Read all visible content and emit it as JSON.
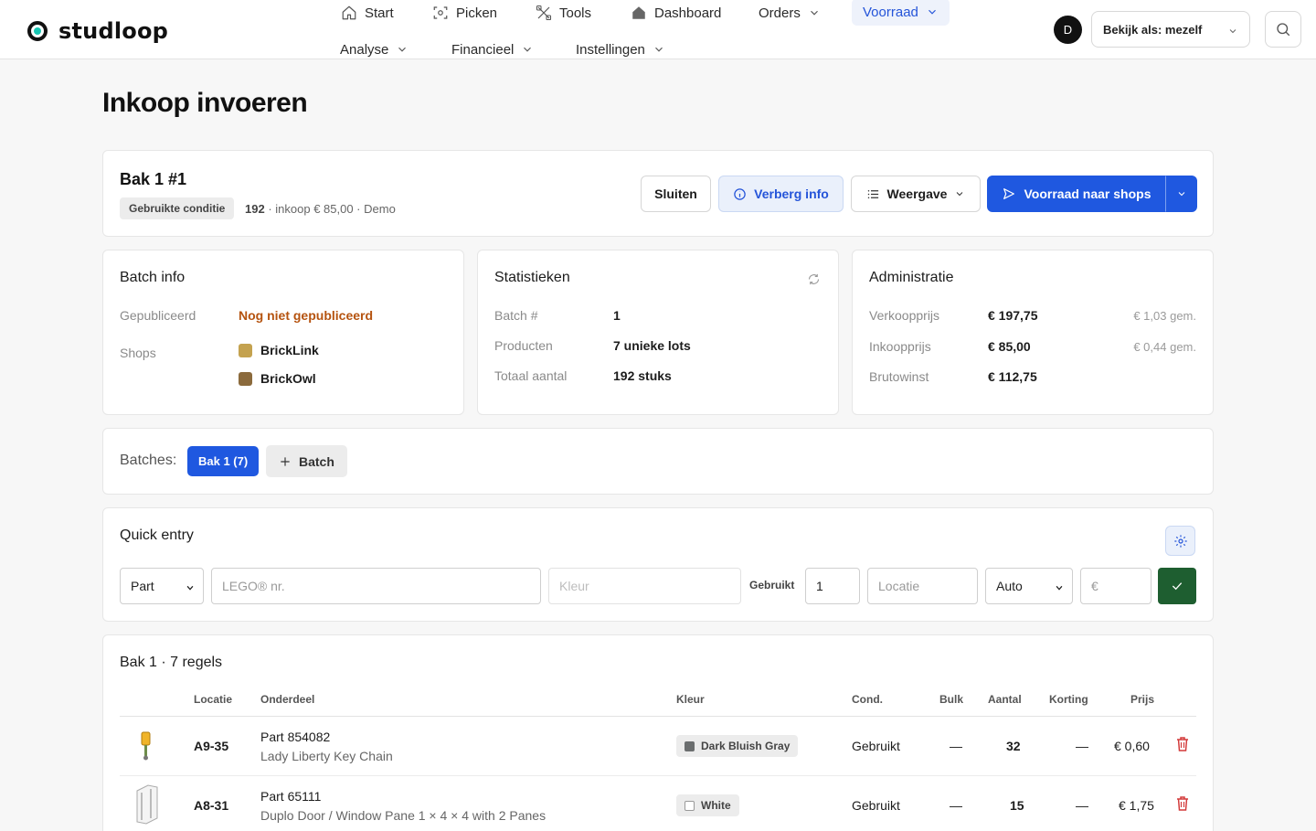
{
  "brand": {
    "name": "studloop"
  },
  "nav": {
    "start": "Start",
    "picken": "Picken",
    "tools": "Tools",
    "dashboard": "Dashboard",
    "orders": "Orders",
    "voorraad": "Voorraad",
    "analyse": "Analyse",
    "financieel": "Financieel",
    "instellingen": "Instellingen"
  },
  "user": {
    "initial": "D",
    "view_as": "Bekijk als: mezelf"
  },
  "page": {
    "title": "Inkoop invoeren"
  },
  "header": {
    "title": "Bak 1 #1",
    "condition": "Gebruikte conditie",
    "count": "192",
    "meta": "· inkoop € 85,00 · Demo",
    "close": "Sluiten",
    "hide_info": "Verberg info",
    "view": "Weergave",
    "push": "Voorraad naar shops"
  },
  "batch_info": {
    "title": "Batch info",
    "published_label": "Gepubliceerd",
    "published_value": "Nog niet gepubliceerd",
    "shops_label": "Shops",
    "shops": [
      {
        "name": "BrickLink",
        "color": "#c4a24f"
      },
      {
        "name": "BrickOwl",
        "color": "#8b6a3c"
      }
    ]
  },
  "stats": {
    "title": "Statistieken",
    "batch_label": "Batch #",
    "batch_value": "1",
    "products_label": "Producten",
    "products_value": "7 unieke lots",
    "total_label": "Totaal aantal",
    "total_value": "192 stuks"
  },
  "admin": {
    "title": "Administratie",
    "sell_label": "Verkoopprijs",
    "sell_value": "€ 197,75",
    "sell_avg": "€ 1,03 gem.",
    "buy_label": "Inkoopprijs",
    "buy_value": "€ 85,00",
    "buy_avg": "€ 0,44 gem.",
    "gross_label": "Brutowinst",
    "gross_value": "€ 112,75"
  },
  "batches": {
    "label": "Batches:",
    "active": "Bak 1 (7)",
    "add": "Batch"
  },
  "quick_entry": {
    "title": "Quick entry",
    "type": "Part",
    "part_placeholder": "LEGO® nr.",
    "color_placeholder": "Kleur",
    "condition": "Gebruikt",
    "qty": "1",
    "location_placeholder": "Locatie",
    "price_mode": "Auto",
    "price_placeholder": "€"
  },
  "list": {
    "title": "Bak 1 · 7 regels",
    "headers": {
      "location": "Locatie",
      "part": "Onderdeel",
      "color": "Kleur",
      "cond": "Cond.",
      "bulk": "Bulk",
      "qty": "Aantal",
      "discount": "Korting",
      "price": "Prijs"
    },
    "rows": [
      {
        "location": "A9-35",
        "part": "Part 854082",
        "name": "Lady Liberty Key Chain",
        "color": "Dark Bluish Gray",
        "color_hex": "#6b6e6f",
        "cond": "Gebruikt",
        "bulk": "—",
        "qty": "32",
        "discount": "—",
        "price": "€ 0,60"
      },
      {
        "location": "A8-31",
        "part": "Part 65111",
        "name": "Duplo Door / Window Pane 1 × 4 × 4 with 2 Panes",
        "color": "White",
        "color_hex": "#ffffff",
        "cond": "Gebruikt",
        "bulk": "—",
        "qty": "15",
        "discount": "—",
        "price": "€ 1,75"
      }
    ]
  },
  "colors": {
    "accent": "#1f58e0",
    "success": "#1e5e30",
    "danger": "#d33a3a",
    "warning": "#b5530f"
  }
}
